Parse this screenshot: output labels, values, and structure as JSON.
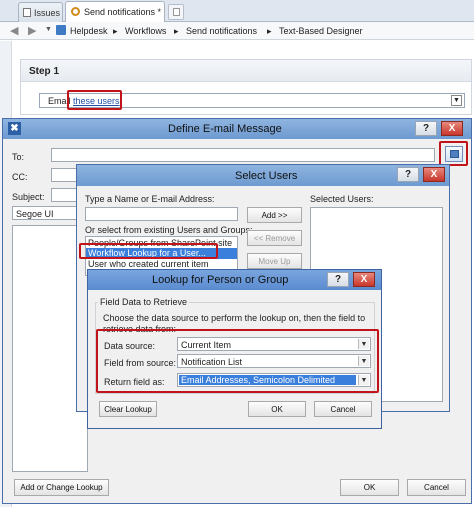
{
  "tabs": [
    {
      "label": "Issues"
    },
    {
      "label": "Send notifications *"
    }
  ],
  "breadcrumb": [
    "Helpdesk",
    "Workflows",
    "Send notifications",
    "Text-Based Designer"
  ],
  "step": {
    "title": "Step 1",
    "action_prefix": "Email",
    "action_link": "these users"
  },
  "email_dialog": {
    "title": "Define E-mail Message",
    "to_label": "To:",
    "cc_label": "CC:",
    "subject_label": "Subject:",
    "font_value": "Segoe UI",
    "add_lookup_button": "Add or Change Lookup",
    "ok_button": "OK",
    "cancel_button": "Cancel",
    "help_button": "?",
    "close_button": "X"
  },
  "select_users": {
    "title": "Select Users",
    "name_label": "Type a Name or E-mail Address:",
    "existing_label": "Or select from existing Users and Groups:",
    "list": [
      "People/Groups from SharePoint site",
      "Workflow Lookup for a User...",
      "User who created current item"
    ],
    "selected_label": "Selected Users:",
    "add_button": "Add >>",
    "remove_button": "<< Remove",
    "move_up_button": "Move Up",
    "help_button": "?",
    "close_button": "X"
  },
  "lookup_dialog": {
    "title": "Lookup for Person or Group",
    "section_label": "Field Data to Retrieve",
    "description": "Choose the data source to perform the lookup on, then the field to retrieve data from:",
    "data_source_label": "Data source:",
    "data_source_value": "Current Item",
    "field_label": "Field from source:",
    "field_value": "Notification List",
    "return_label": "Return field as:",
    "return_value": "Email Addresses, Semicolon Delimited",
    "clear_button": "Clear Lookup",
    "ok_button": "OK",
    "cancel_button": "Cancel",
    "help_button": "?",
    "close_button": "X"
  },
  "colors": {
    "title_bar": "#6d9ad0",
    "title_bar_active": "#5b8bd0",
    "highlight_red": "#c0141a",
    "selection_blue": "#3b7fdc",
    "link_blue": "#1d4ea8"
  }
}
